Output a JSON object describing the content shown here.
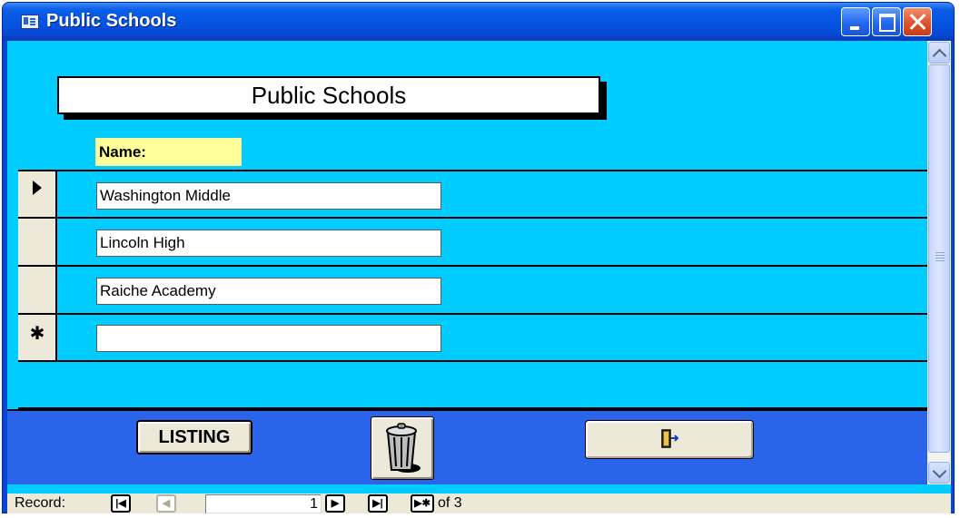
{
  "window": {
    "title": "Public Schools",
    "controls": {
      "minimize_icon": "minimize-icon",
      "maximize_icon": "maximize-icon",
      "close_icon": "close-icon"
    }
  },
  "form": {
    "heading": "Public Schools",
    "column_label": "Name:",
    "rows": [
      {
        "name": "Washington Middle",
        "selector": "current-record-arrow"
      },
      {
        "name": "Lincoln High",
        "selector": ""
      },
      {
        "name": "Raiche Academy",
        "selector": ""
      },
      {
        "name": "",
        "selector": "new-record-asterisk"
      }
    ],
    "new_record_glyph": "✱"
  },
  "footer": {
    "listing_button_label": "LISTING",
    "delete_button_icon": "trash-can-icon",
    "exit_button_icon": "exit-door-icon"
  },
  "navigation": {
    "label": "Record:",
    "current_record": "1",
    "total_text": "of  3",
    "buttons": {
      "first": "first-record-icon",
      "previous": "previous-record-icon",
      "next": "next-record-icon",
      "last": "last-record-icon",
      "new": "new-record-icon"
    }
  },
  "colors": {
    "form_background": "#00ccff",
    "footer_background": "#2a64ea",
    "label_background": "#ffff99",
    "titlebar": "#0452e0"
  }
}
